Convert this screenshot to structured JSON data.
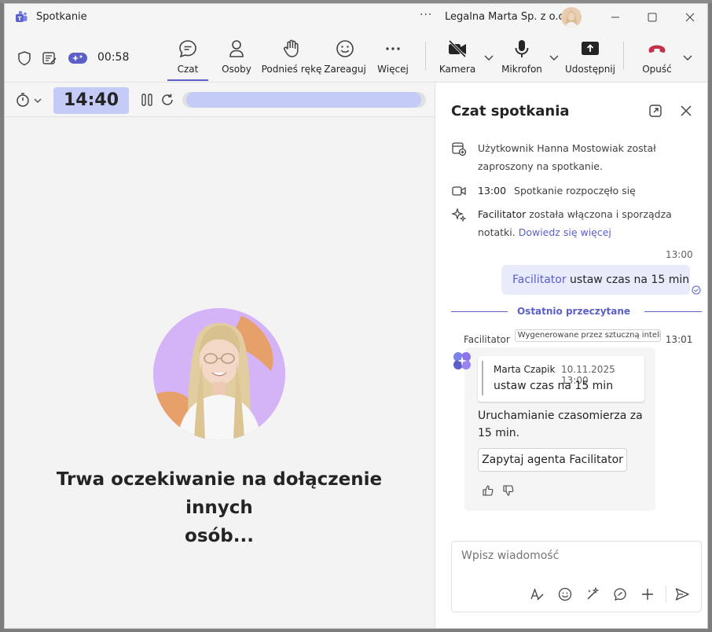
{
  "window": {
    "title": "Spotkanie",
    "more": "···",
    "org": "Legalna Marta Sp. z o.o."
  },
  "toolbar": {
    "elapsed": "00:58",
    "tools": {
      "chat": "Czat",
      "people": "Osoby",
      "raise_hand": "Podnieś rękę",
      "react": "Zareaguj",
      "more": "Więcej",
      "camera": "Kamera",
      "mic": "Mikrofon",
      "share": "Udostępnij",
      "leave": "Opuść"
    }
  },
  "stage": {
    "timer_value": "14:40",
    "progress_fraction": 0.98,
    "waiting_line1": "Trwa oczekiwanie na dołączenie innych",
    "waiting_line2": "osób..."
  },
  "chat": {
    "title": "Czat spotkania",
    "events": {
      "invited": "Użytkownik Hanna Mostowiak został zaproszony na spotkanie.",
      "started_time": "13:00",
      "started_text": "Spotkanie rozpoczęło się",
      "facilitator_name": "Facilitator",
      "facilitator_text": " została włączona i sporządza notatki. ",
      "learn_more": "Dowiedz się więcej"
    },
    "my_message": {
      "time": "13:00",
      "mention": "Facilitator",
      "text": " ustaw czas na 15 min"
    },
    "divider": "Ostatnio przeczytane",
    "bot": {
      "name": "Facilitator",
      "ai_label": "Wygenerowane przez sztuczną inteligencję",
      "time": "13:01",
      "quote_author": "Marta Czapik",
      "quote_date": "10.11.2025 13:00",
      "quote_text": "ustaw czas na 15 min",
      "reply": "Uruchamianie czasomierza za 15 min.",
      "ask_button": "Zapytaj agenta Facilitator"
    },
    "composer": {
      "placeholder": "Wpisz wiadomość"
    }
  },
  "colors": {
    "accent": "#5b5fc7",
    "leave_red": "#c4314b",
    "timer_bg": "#c5cbf7",
    "portrait_bg": "#d4b3f7",
    "portrait_orange": "#e8a06b"
  }
}
